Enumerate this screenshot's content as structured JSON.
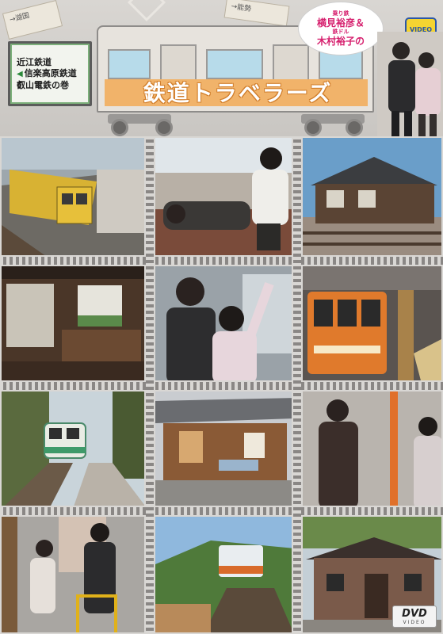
{
  "header": {
    "series_title": "鉄道トラベラーズ",
    "sign_lines": [
      "近江鉄道",
      "信楽高原鉄道",
      "叡山電鉄の巻"
    ],
    "bubble": {
      "line1_small": "乗り鉄",
      "line1_name": "横見裕彦＆",
      "line2_small": "鉄ドル",
      "line2_name": "木村裕子の"
    },
    "ticket_left": "→湖国",
    "ticket_right": "→能勢",
    "logo": "VIDEO"
  },
  "dvd_badge": {
    "main": "DVD",
    "sub": "VIDEO"
  },
  "colors": {
    "title_outline": "#d07d2a",
    "stripe": "#f1b36a",
    "bubble_text": "#d6206e",
    "sign_border": "#7cb07a"
  },
  "photos": [
    {
      "id": "yellow-train-station"
    },
    {
      "id": "sleeping-passenger"
    },
    {
      "id": "wooden-station-building"
    },
    {
      "id": "station-interior"
    },
    {
      "id": "hosts-waving"
    },
    {
      "id": "orange-train"
    },
    {
      "id": "green-train-platform"
    },
    {
      "id": "platform-shelter"
    },
    {
      "id": "hosts-standing"
    },
    {
      "id": "host-on-platform"
    },
    {
      "id": "bridge-train"
    },
    {
      "id": "wooden-hut"
    }
  ]
}
